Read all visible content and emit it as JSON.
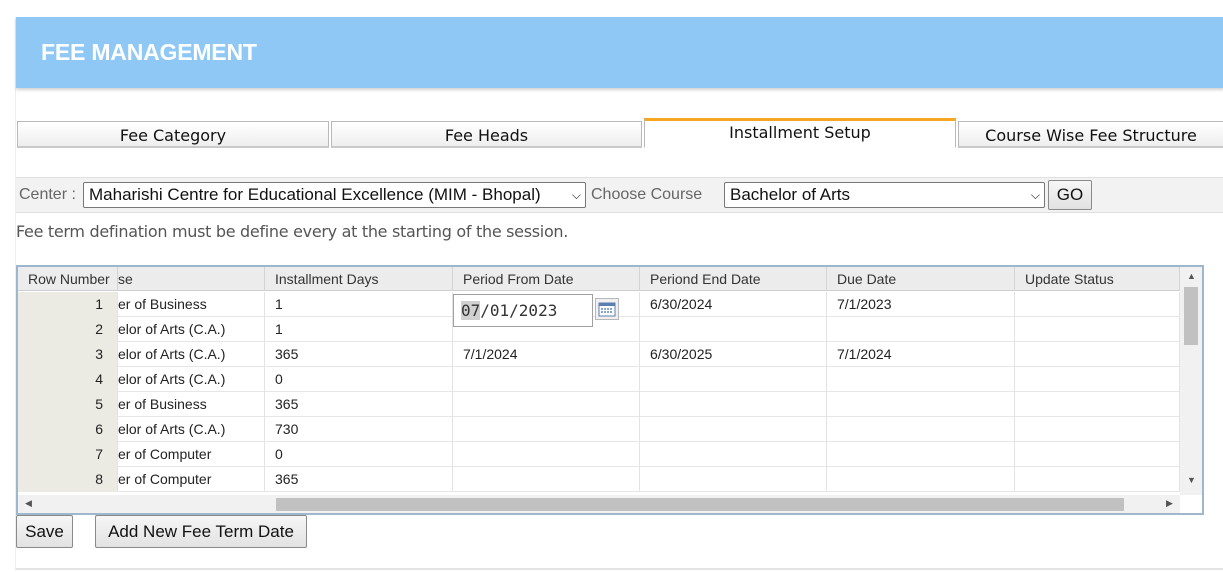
{
  "header": {
    "title": "FEE MANAGEMENT"
  },
  "tabs": [
    {
      "label": "Fee Category",
      "active": false
    },
    {
      "label": "Fee Heads",
      "active": false
    },
    {
      "label": "Installment Setup",
      "active": true
    },
    {
      "label": "Course Wise Fee Structure",
      "active": false
    }
  ],
  "filters": {
    "center_label": "Center :",
    "center_value": "Maharishi Centre for Educational Excellence (MIM - Bhopal)",
    "course_label": "Choose Course",
    "course_value": "Bachelor of Arts",
    "go_label": "GO"
  },
  "note": "Fee term defination must be define every at the starting of the session.",
  "grid": {
    "columns": [
      "Row Number",
      "se",
      "Installment Days",
      "Period From Date",
      "Periond End Date",
      "Due Date",
      "Update Status"
    ],
    "rows": [
      {
        "num": "1",
        "course": "er of Business",
        "days": "1",
        "from": "",
        "end": "6/30/2024",
        "due": "7/1/2023",
        "status": ""
      },
      {
        "num": "2",
        "course": "elor of Arts (C.A.)",
        "days": "1",
        "from": "",
        "end": "",
        "due": "",
        "status": ""
      },
      {
        "num": "3",
        "course": "elor of Arts (C.A.)",
        "days": "365",
        "from": "7/1/2024",
        "end": "6/30/2025",
        "due": "7/1/2024",
        "status": ""
      },
      {
        "num": "4",
        "course": "elor of Arts (C.A.)",
        "days": "0",
        "from": "",
        "end": "",
        "due": "",
        "status": ""
      },
      {
        "num": "5",
        "course": "er of Business",
        "days": "365",
        "from": "",
        "end": "",
        "due": "",
        "status": ""
      },
      {
        "num": "6",
        "course": "elor of Arts (C.A.)",
        "days": "730",
        "from": "",
        "end": "",
        "due": "",
        "status": ""
      },
      {
        "num": "7",
        "course": "er of Computer",
        "days": "0",
        "from": "",
        "end": "",
        "due": "",
        "status": ""
      },
      {
        "num": "8",
        "course": "er of Computer",
        "days": "365",
        "from": "",
        "end": "",
        "due": "",
        "status": ""
      }
    ],
    "date_editor": {
      "month": "07",
      "rest": "/01/2023"
    }
  },
  "buttons": {
    "save": "Save",
    "add_new": "Add New Fee Term Date"
  },
  "icons": {
    "calendar": "calendar-icon",
    "scroll_up": "arrow-up-icon",
    "scroll_down": "arrow-down-icon",
    "scroll_left": "arrow-left-icon",
    "scroll_right": "arrow-right-icon"
  },
  "colors": {
    "header_bg": "#8fc8f5",
    "active_tab_accent": "#f5a623",
    "grid_border": "#9fb7cc"
  }
}
